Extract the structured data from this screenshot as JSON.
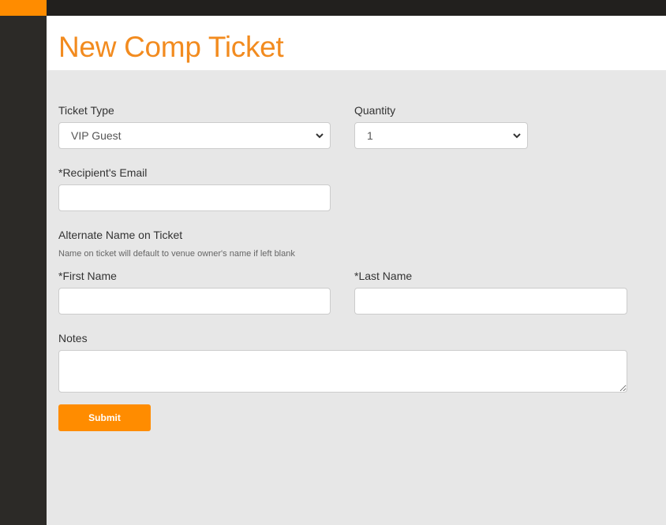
{
  "header": {
    "title": "New Comp Ticket"
  },
  "colors": {
    "accent": "#ff8c00",
    "title": "#f28b1f",
    "sidebar": "#2c2a27",
    "topbar": "#22201e",
    "content_bg": "#e7e7e7"
  },
  "form": {
    "ticket_type": {
      "label": "Ticket Type",
      "value": "VIP Guest"
    },
    "quantity": {
      "label": "Quantity",
      "value": "1"
    },
    "recipient_email": {
      "label": "*Recipient's Email",
      "value": "",
      "placeholder": ""
    },
    "alternate_name": {
      "heading": "Alternate Name on Ticket",
      "hint": "Name on ticket will default to venue owner's name if left blank"
    },
    "first_name": {
      "label": "*First Name",
      "value": "",
      "placeholder": ""
    },
    "last_name": {
      "label": "*Last Name",
      "value": "",
      "placeholder": ""
    },
    "notes": {
      "label": "Notes",
      "value": "",
      "placeholder": ""
    },
    "submit_label": "Submit"
  }
}
